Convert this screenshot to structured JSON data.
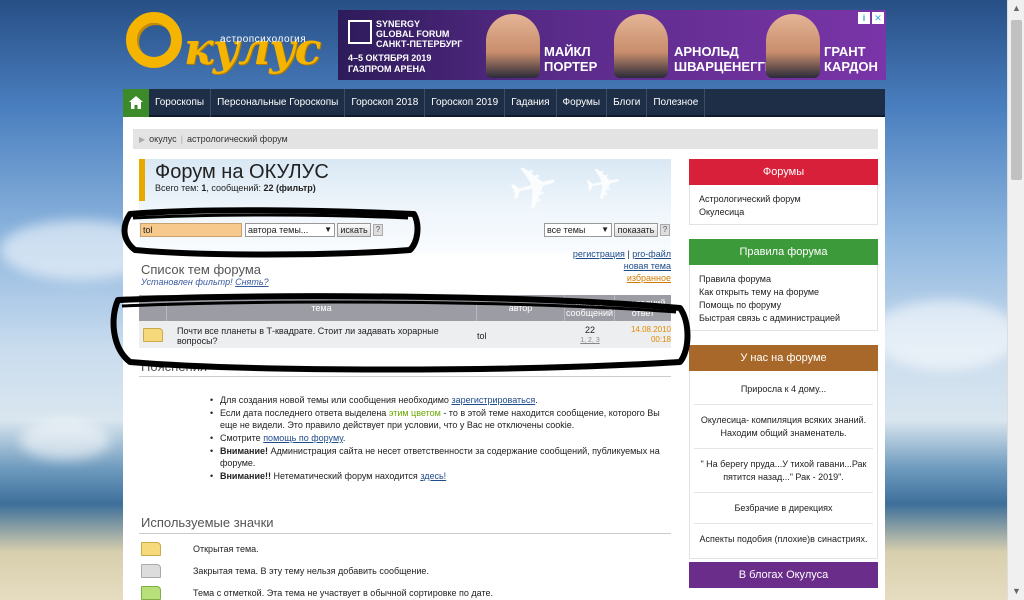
{
  "logo": {
    "subtitle": "астропсихология",
    "word": "кулус",
    "letter": "О"
  },
  "ad": {
    "brand": "SYNERGY\nGLOBAL FORUM\nСАНКТ-ПЕТЕРБУРГ",
    "date": "4–5 ОКТЯБРЯ 2019\nГАЗПРОМ АРЕНА",
    "speakers": [
      {
        "name": "МАЙКЛ\nПОРТЕР"
      },
      {
        "name": "АРНОЛЬД\nШВАРЦЕНЕГГЕР"
      },
      {
        "name": "ГРАНТ\nКАРДОН"
      }
    ]
  },
  "nav": {
    "items": [
      "Гороскопы",
      "Персональные Гороскопы",
      "Гороскоп 2018",
      "Гороскоп 2019",
      "Гадания",
      "Форумы",
      "Блоги",
      "Полезное"
    ]
  },
  "breadcrumb": {
    "home": "окулус",
    "current": "астрологический форум"
  },
  "forum": {
    "title": "Форум на ОКУЛУС",
    "stats_prefix": "Всего тем: ",
    "topics": "1",
    "stats_mid": ", сообщений: ",
    "messages": "22 (фильтр)"
  },
  "filter": {
    "query": "tol",
    "field_select": "автора темы...",
    "search_button": "искать",
    "help": "?",
    "scope_select": "все темы",
    "show_button": "показать"
  },
  "links": {
    "register": "регистрация",
    "sep": "|",
    "profile": "pro-файл",
    "new_topic": "новая тема",
    "favorites": "избранное"
  },
  "topic_list": {
    "title": "Список тем форума",
    "filter_note": "Установлен фильтр!",
    "reset": "Снять?",
    "headers": {
      "topic": "тема",
      "author": "автор",
      "count": "Кол-во сообщений",
      "last": "последний ответ"
    },
    "rows": [
      {
        "topic": "Почти все планеты в Т-квадрате. Стоит ли задавать хорарные вопросы?",
        "author": "tol",
        "count": "22",
        "pages": "1, 2, 3",
        "last_date": "14.08.2010",
        "last_time": "00:18"
      }
    ]
  },
  "notes": {
    "title": "Пояснения",
    "items": [
      {
        "pre": "Для создания новой темы или сообщения необходимо ",
        "link": "зарегистрироваться",
        "post": "."
      },
      {
        "pre": "Если дата последнего ответа выделена ",
        "colored": "этим цветом",
        "post": " - то в этой теме находится сообщение, которого Вы еще не видели. Это правило действует при условии, что у Вас не отключены cookie."
      },
      {
        "pre": "Смотрите ",
        "link": "помощь по форуму",
        "post": "."
      },
      {
        "bold": "Внимание!",
        "post": " Администрация сайта не несет ответственности за содержание сообщений, публикуемых на форуме."
      },
      {
        "bold": "Внимание!!",
        "post": " Нетематический форум находится ",
        "link": "здесь!",
        "end": ""
      }
    ]
  },
  "icons_legend": {
    "title": "Используемые значки",
    "items": [
      {
        "icon": "folder-open-icon",
        "text": "Открытая тема."
      },
      {
        "icon": "folder-closed-icon",
        "text": "Закрытая тема. В эту тему нельзя добавить сообщение."
      },
      {
        "icon": "folder-marked-icon",
        "text": "Тема с отметкой. Эта тема не участвует в обычной сортировке по дате."
      }
    ]
  },
  "sidebar": {
    "forums": {
      "title": "Форумы",
      "color": "#d8203a",
      "items": [
        "Астрологический форум",
        "Окулесица"
      ]
    },
    "rules": {
      "title": "Правила форума",
      "color": "#3d9a3a",
      "items": [
        "Правила форума",
        "Как открыть тему на форуме",
        "Помощь по форуму",
        "Быстрая связь с администрацией"
      ]
    },
    "on_forum": {
      "title": "У нас на форуме",
      "color": "#a8682a",
      "items": [
        "Приросла к 4 дому...",
        "Окулесица- компиляция всяких знаний. Находим общий знаменатель.",
        "\" На берегу пруда...У тихой гавани...Рак пятится назад...\" Рак - 2019\".",
        "Безбрачие в дирекциях",
        "Аспекты подобия (плохие)в синастриях."
      ]
    },
    "blogs": {
      "title": "В блогах Окулуса",
      "color": "#6a2e8a"
    }
  }
}
